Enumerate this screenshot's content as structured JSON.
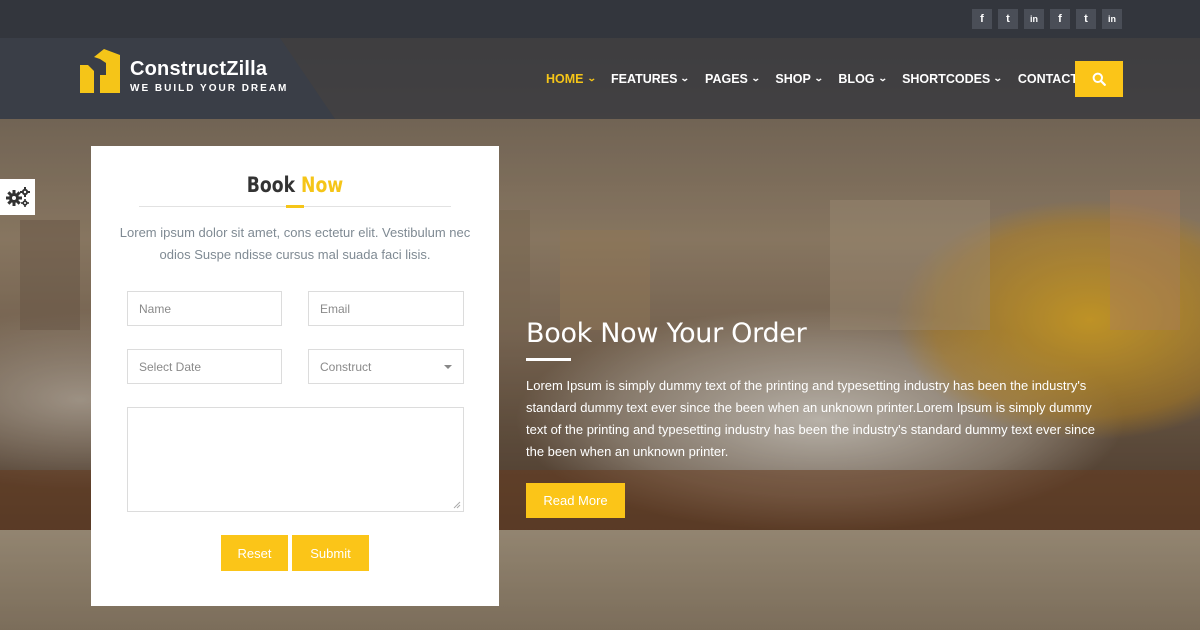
{
  "social": {
    "links": [
      {
        "icon": "facebook-icon",
        "glyph": "f"
      },
      {
        "icon": "twitter-icon",
        "glyph": "t"
      },
      {
        "icon": "linkedin-icon",
        "glyph": "in"
      },
      {
        "icon": "facebook-icon",
        "glyph": "f"
      },
      {
        "icon": "twitter-icon",
        "glyph": "t"
      },
      {
        "icon": "linkedin-icon",
        "glyph": "in"
      }
    ]
  },
  "brand": {
    "name": "ConstructZilla",
    "tagline": "WE BUILD YOUR DREAM",
    "accent_color": "#f5c518"
  },
  "nav": {
    "items": [
      {
        "label": "HOME",
        "active": true
      },
      {
        "label": "FEATURES",
        "active": false
      },
      {
        "label": "PAGES",
        "active": false
      },
      {
        "label": "SHOP",
        "active": false
      },
      {
        "label": "BLOG",
        "active": false
      },
      {
        "label": "SHORTCODES",
        "active": false
      },
      {
        "label": "CONTACT US",
        "active": false
      }
    ],
    "search_icon": "search-icon"
  },
  "settings": {
    "icon": "gears-icon"
  },
  "booking": {
    "title_part1": "Book",
    "title_part2": "Now",
    "description": "Lorem ipsum dolor sit amet, cons ectetur elit. Vestibulum nec odios Suspe ndisse cursus mal suada faci lisis.",
    "name_placeholder": "Name",
    "email_placeholder": "Email",
    "date_placeholder": "Select Date",
    "construct_selected": "Construct",
    "message_value": "",
    "reset_label": "Reset",
    "submit_label": "Submit"
  },
  "hero": {
    "title": "Book Now Your Order",
    "text": "Lorem Ipsum is simply dummy text of the printing and typesetting industry has been the industry's standard dummy text ever since the been when an unknown printer.Lorem Ipsum is simply dummy text of the printing and typesetting industry has been the industry's standard dummy text ever since the been when an unknown printer.",
    "button_label": "Read More"
  }
}
